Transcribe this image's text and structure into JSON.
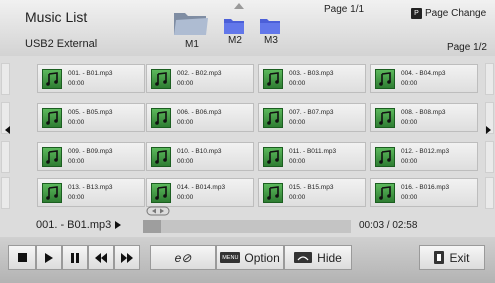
{
  "header": {
    "title": "Music List",
    "source": "USB2 External",
    "page_top": "Page 1/1",
    "page_change_key": "P",
    "page_change_label": "Page Change",
    "page_sub": "Page 1/2",
    "folders": [
      {
        "label": "M1",
        "state": "open"
      },
      {
        "label": "M2",
        "state": "closed"
      },
      {
        "label": "M3",
        "state": "closed"
      }
    ]
  },
  "tracks": [
    {
      "name": "001. - B01.mp3",
      "duration": "00:00"
    },
    {
      "name": "002. - B02.mp3",
      "duration": "00:00"
    },
    {
      "name": "003. - B03.mp3",
      "duration": "00:00"
    },
    {
      "name": "004. - B04.mp3",
      "duration": "00:00"
    },
    {
      "name": "005. - B05.mp3",
      "duration": "00:00"
    },
    {
      "name": "006. - B06.mp3",
      "duration": "00:00"
    },
    {
      "name": "007. - B07.mp3",
      "duration": "00:00"
    },
    {
      "name": "008. - B08.mp3",
      "duration": "00:00"
    },
    {
      "name": "009. - B09.mp3",
      "duration": "00:00"
    },
    {
      "name": "010. - B10.mp3",
      "duration": "00:00"
    },
    {
      "name": "011. - B011.mp3",
      "duration": "00:00"
    },
    {
      "name": "012. - B012.mp3",
      "duration": "00:00"
    },
    {
      "name": "013. - B13.mp3",
      "duration": "00:00"
    },
    {
      "name": "014. - B014.mp3",
      "duration": "00:00"
    },
    {
      "name": "015. - B15.mp3",
      "duration": "00:00"
    },
    {
      "name": "016. - B016.mp3",
      "duration": "00:00"
    }
  ],
  "player": {
    "now_playing": "001. - B01.mp3",
    "time": "00:03 / 02:58",
    "progress_fraction": 0.017
  },
  "controls": {
    "option_key": "MENU",
    "option_label": "Option",
    "hide_label": "Hide",
    "exit_label": "Exit",
    "repeat_symbol": "e⊘"
  },
  "colors": {
    "tile_icon": "#3a9a3e",
    "folder": "#5b6ee0",
    "folder_open": "#8fa0b8"
  }
}
